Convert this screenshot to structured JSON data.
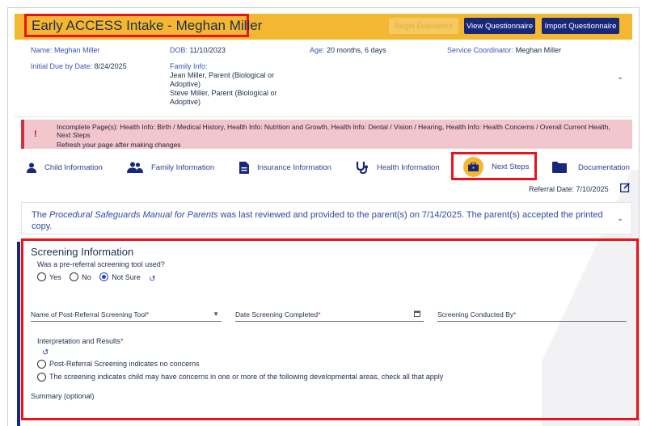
{
  "header": {
    "title": "Early ACCESS Intake - Meghan Miller",
    "begin_evaluation": "Begin Evaluation",
    "view_questionnaire": "View Questionnaire",
    "import_questionnaire": "Import Questionnaire"
  },
  "summary": {
    "name": "Name: Meghan Miller",
    "dob_label": "DOB:",
    "dob": "11/10/2023",
    "age_label": "Age:",
    "age": "20 months, 6 days",
    "coordinator_label": "Service Coordinator:",
    "coordinator": "Meghan Miller",
    "initial_due_label": "Initial Due by Date:",
    "initial_due": "8/24/2025",
    "family_label": "Family Info:",
    "family_1": "Jean Miller, Parent (Biological or Adoptive)",
    "family_2": "Steve Miller, Parent (Biological or Adoptive)"
  },
  "alert": {
    "message": "Incomplete Page(s): Health Info: Birth / Medical History, Health Info: Nutrition and Growth, Health Info: Dental / Vision / Hearing, Health Info: Health Concerns / Overall Current Health, Next Steps",
    "refresh": "Refresh your page after making changes"
  },
  "nav": {
    "child": "Child Information",
    "family": "Family Information",
    "insurance": "Insurance Information",
    "health": "Health Information",
    "next": "Next Steps",
    "documentation": "Documentation"
  },
  "referral": {
    "label": "Referral Date:",
    "date": "7/10/2025"
  },
  "safeguards": {
    "prefix": "The ",
    "title": "Procedural Safeguards Manual for Parents",
    "suffix": " was last reviewed and provided to the parent(s) on 7/14/2025. The parent(s) accepted the printed copy."
  },
  "screening": {
    "section_title": "Screening Information",
    "question": "Was a pre-referral screening tool used?",
    "options": [
      "Yes",
      "No",
      "Not Sure"
    ],
    "selected": "Not Sure",
    "tool_label": "Name of Post-Referral Screening Tool",
    "date_label": "Date Screening Completed",
    "conducted_label": "Screening Conducted By",
    "required_mark": "*",
    "interp_label": "Interpretation and Results",
    "result_1": "Post-Referral Screening indicates no concerns",
    "result_2": "The screening indicates child may have concerns in one or more of the following developmental areas, check all that apply",
    "summary_label": "Summary (optional)"
  },
  "colors": {
    "accent": "#f4b731",
    "navy": "#17287a",
    "highlight": "#e8141c",
    "alert_bg": "#f1c6cd"
  }
}
